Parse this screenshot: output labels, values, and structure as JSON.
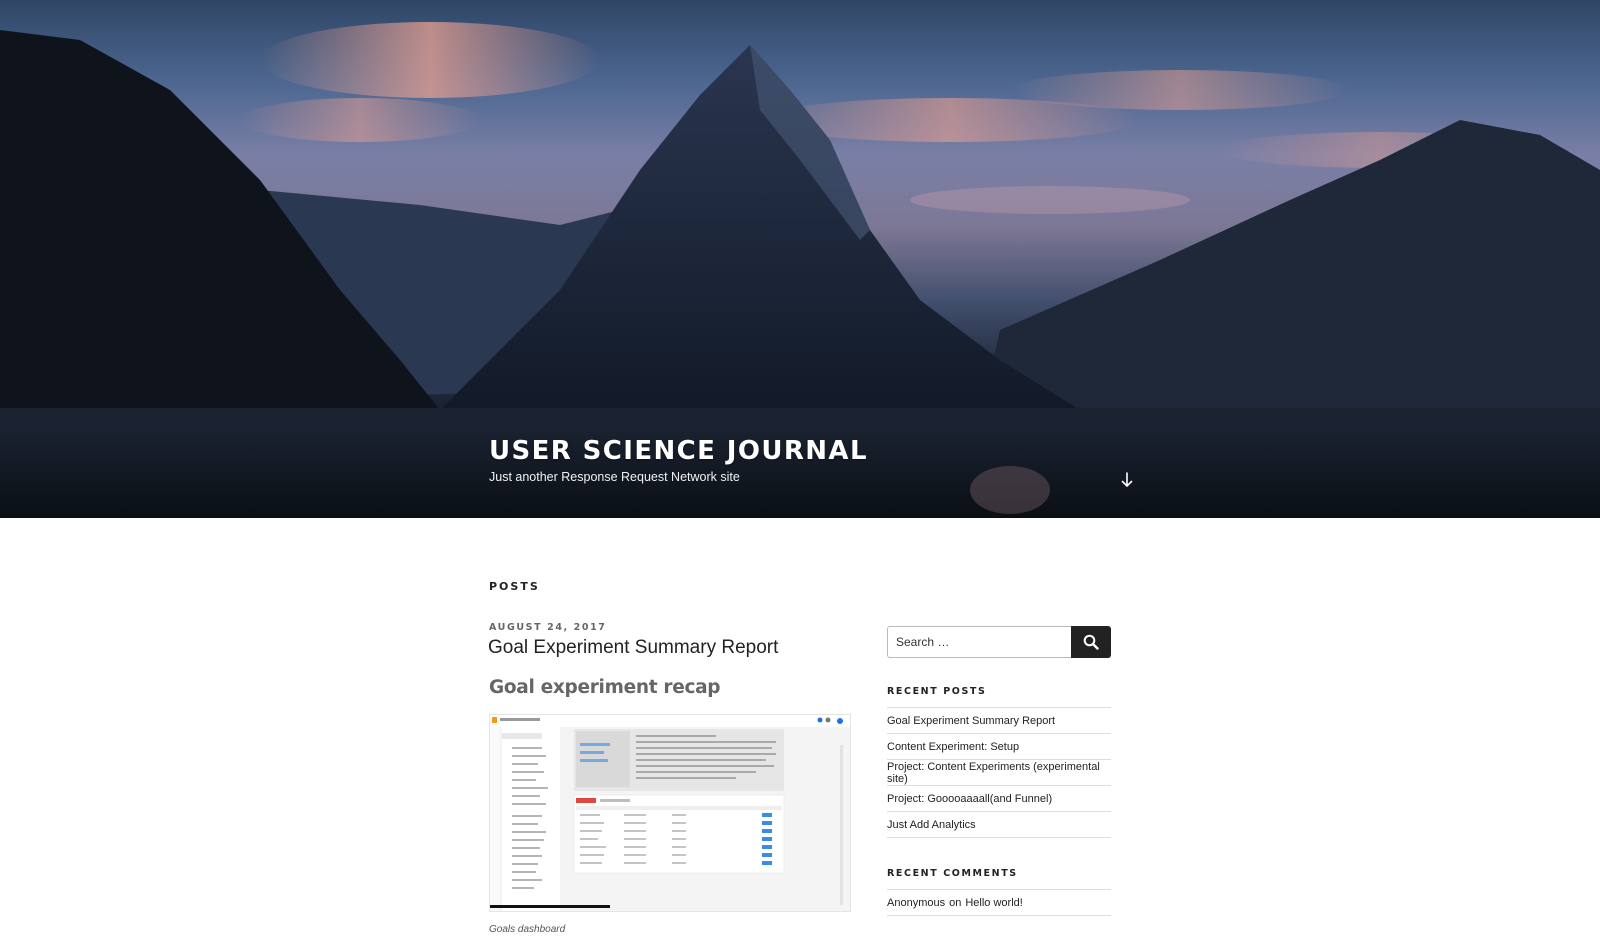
{
  "header": {
    "site_title": "USER SCIENCE JOURNAL",
    "site_description": "Just another Response Request Network site",
    "scroll_icon": "arrow-down-icon"
  },
  "main": {
    "section_heading": "POSTS",
    "post": {
      "date": "AUGUST 24, 2017",
      "title": "Goal Experiment Summary Report",
      "subheading": "Goal experiment recap",
      "figure_caption": "Goals dashboard"
    }
  },
  "sidebar": {
    "search": {
      "placeholder": "Search …",
      "button_icon": "search-icon"
    },
    "recent_posts": {
      "title": "RECENT POSTS",
      "items": [
        "Goal Experiment Summary Report",
        "Content Experiment: Setup",
        "Project: Content Experiments (experimental site)",
        "Project: Gooooaaaall(and Funnel)",
        "Just Add Analytics"
      ]
    },
    "recent_comments": {
      "title": "RECENT COMMENTS",
      "items": [
        {
          "author": "Anonymous",
          "connector": "on",
          "post": "Hello world!"
        }
      ]
    }
  },
  "colors": {
    "text": "#222222",
    "muted": "#666666",
    "button": "#222222",
    "rule": "#dddddd"
  }
}
